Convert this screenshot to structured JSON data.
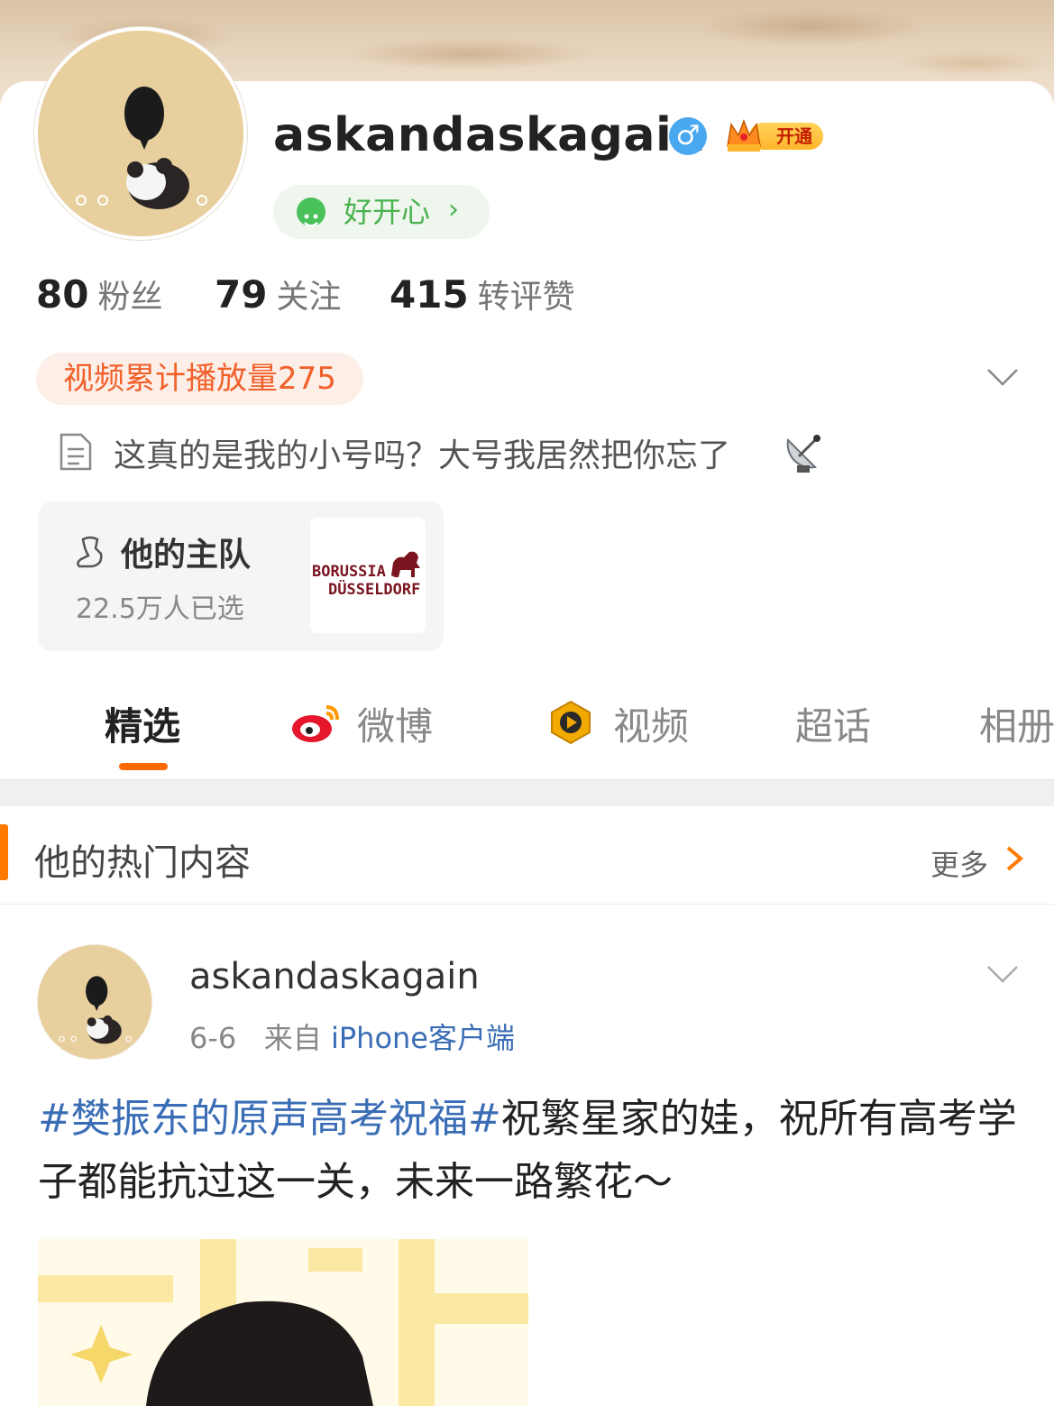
{
  "profile": {
    "username": "askandaskagain",
    "gender_icon": "male-icon",
    "vip_label": "开通",
    "mood": "好开心",
    "stats": [
      {
        "num": "80",
        "label": "粉丝"
      },
      {
        "num": "79",
        "label": "关注"
      },
      {
        "num": "415",
        "label": "转评赞"
      }
    ],
    "video_plays": "视频累计播放量275",
    "bio": "这真的是我的小号吗？大号我居然把你忘了"
  },
  "team": {
    "title": "他的主队",
    "count": "22.5万人已选",
    "logo_line1": "BORUSSIA",
    "logo_line2": "DÜSSELDORF"
  },
  "tabs": [
    {
      "label": "精选",
      "active": true
    },
    {
      "label": "微博",
      "icon": "weibo-icon"
    },
    {
      "label": "视频",
      "icon": "video-play-icon"
    },
    {
      "label": "超话"
    },
    {
      "label": "相册"
    }
  ],
  "section": {
    "title": "他的热门内容",
    "more": "更多"
  },
  "post": {
    "username": "askandaskagain",
    "date": "6-6",
    "from": "来自",
    "source": "iPhone客户端",
    "topic": "#樊振东的原声高考祝福#",
    "text": "祝繁星家的娃，祝所有高考学子都能抗过这一关，未来一路繁花～"
  },
  "colors": {
    "accent": "#ff6a00",
    "link": "#3a6db5",
    "mood_green": "#49b34f",
    "video_pill_text": "#f2602a"
  }
}
